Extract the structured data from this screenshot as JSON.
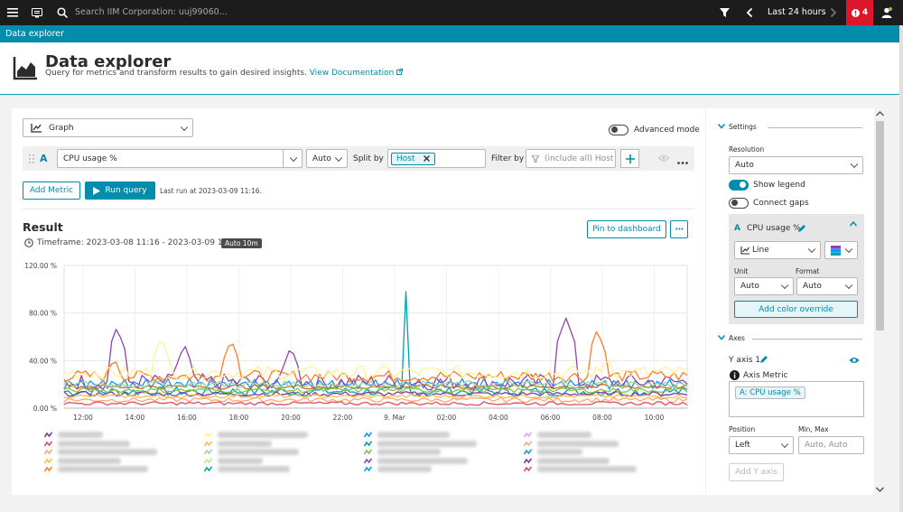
{
  "topbar": {
    "search_placeholder": "Search IIM Corporation: uuj99060...",
    "timeframe": "Last 24 hours",
    "alert_count": "4"
  },
  "breadcrumb": "Data explorer",
  "header": {
    "title": "Data explorer",
    "subtitle": "Query for metrics and transform results to gain desired insights.",
    "doc_link": "View Documentation"
  },
  "query": {
    "visualization": "Graph",
    "advanced_mode_label": "Advanced mode",
    "advanced_mode_on": false,
    "row_letter": "A",
    "metric": "CPU usage %",
    "aggregation": "Auto",
    "split_by_label": "Split by",
    "split_by_value": "Host",
    "filter_by_label": "Filter by",
    "filter_placeholder": "(include all)  Host",
    "add_metric": "Add Metric",
    "run_query": "Run query",
    "last_run": "Last run at 2023-03-09 11:16."
  },
  "result": {
    "title": "Result",
    "timeframe": "Timeframe: 2023-03-08 11:16 - 2023-03-09 11:16",
    "badge": "Auto 10m",
    "pin_button": "Pin to dashboard",
    "more_button": "•••"
  },
  "chart_data": {
    "type": "line",
    "y_ticks": [
      "120.00 %",
      "80.00 %",
      "40.00 %",
      "0.00 %"
    ],
    "ylim": [
      0,
      120
    ],
    "x_ticks": [
      "12:00",
      "14:00",
      "16:00",
      "18:00",
      "20:00",
      "22:00",
      "9. Mar",
      "02:00",
      "04:00",
      "06:00",
      "08:00",
      "10:00"
    ],
    "x_start_hour": 11.27,
    "x_end_hour": 35.27,
    "grid": true,
    "series": [
      {
        "color": "#1496ff",
        "kind": "sawtooth",
        "low": 16,
        "high": 25,
        "period": 0.42
      },
      {
        "color": "#00a1b2",
        "kind": "spike",
        "base": 14,
        "noise": 4,
        "spike_at": 24.4,
        "spike_value": 98
      },
      {
        "color": "#8e44ad",
        "kind": "bursts",
        "base": 22,
        "noise": 7,
        "bursts": [
          [
            13.3,
            68
          ],
          [
            15.9,
            54
          ],
          [
            20.0,
            52
          ],
          [
            30.6,
            76
          ]
        ]
      },
      {
        "color": "#ff7b23",
        "kind": "bursts",
        "base": 27,
        "noise": 5,
        "bursts": [
          [
            13.2,
            43
          ],
          [
            17.7,
            58
          ],
          [
            31.8,
            66
          ]
        ]
      },
      {
        "color": "#fff29a",
        "kind": "bursts",
        "base": 30,
        "noise": 6,
        "bursts": [
          [
            15.0,
            60
          ],
          [
            32.2,
            44
          ]
        ]
      },
      {
        "color": "#7c38a1",
        "kind": "flat",
        "base": 12,
        "noise": 2
      },
      {
        "color": "#ffa86c",
        "kind": "flat",
        "base": 7,
        "noise": 2
      },
      {
        "color": "#f8bd46",
        "kind": "flat",
        "base": 10,
        "noise": 1.5
      },
      {
        "color": "#e44a68",
        "kind": "flat",
        "base": 4,
        "noise": 1.5
      },
      {
        "color": "#bd6e2e",
        "kind": "flat",
        "base": 18,
        "noise": 2
      },
      {
        "color": "#a0d59e",
        "kind": "flat",
        "base": 20,
        "noise": 3
      },
      {
        "color": "#7dc540",
        "kind": "flat",
        "base": 15,
        "noise": 2
      }
    ]
  },
  "legend_icon_colors": [
    [
      "#7c38a1",
      "#e44a68",
      "#ffa86c",
      "#f8bd46",
      "#ff7b23"
    ],
    [
      "#fff29a",
      "#f8bd46",
      "#a0d59e",
      "#c6e28a",
      "#00a1b2"
    ],
    [
      "#1496ff",
      "#00a1b2",
      "#7dc540",
      "#8e44ad",
      "#1496ff"
    ],
    [
      "#d7a5f5",
      "#ffa86c",
      "#1496ff",
      "#7c38a1",
      "#e44a68"
    ]
  ],
  "settings": {
    "section_title": "Settings",
    "resolution_label": "Resolution",
    "resolution_value": "Auto",
    "show_legend_label": "Show legend",
    "show_legend_on": true,
    "connect_gaps_label": "Connect gaps",
    "connect_gaps_on": false,
    "metric_letter": "A",
    "metric_name": "CPU usage %",
    "chart_type": "Line",
    "unit_label": "Unit",
    "unit_value": "Auto",
    "format_label": "Format",
    "format_value": "Auto",
    "add_color_override": "Add color override"
  },
  "axes": {
    "section_title": "Axes",
    "y_axis_title": "Y axis 1",
    "axis_metric_label": "Axis Metric",
    "axis_metric_chip": "A: CPU usage %",
    "position_label": "Position",
    "position_value": "Left",
    "minmax_label": "Min, Max",
    "minmax_placeholder": "Auto, Auto",
    "add_y_axis": "Add Y axis"
  },
  "colors": {
    "accent": "#008cad",
    "topbar": "#1c1c1c",
    "alert": "#dc172a"
  }
}
